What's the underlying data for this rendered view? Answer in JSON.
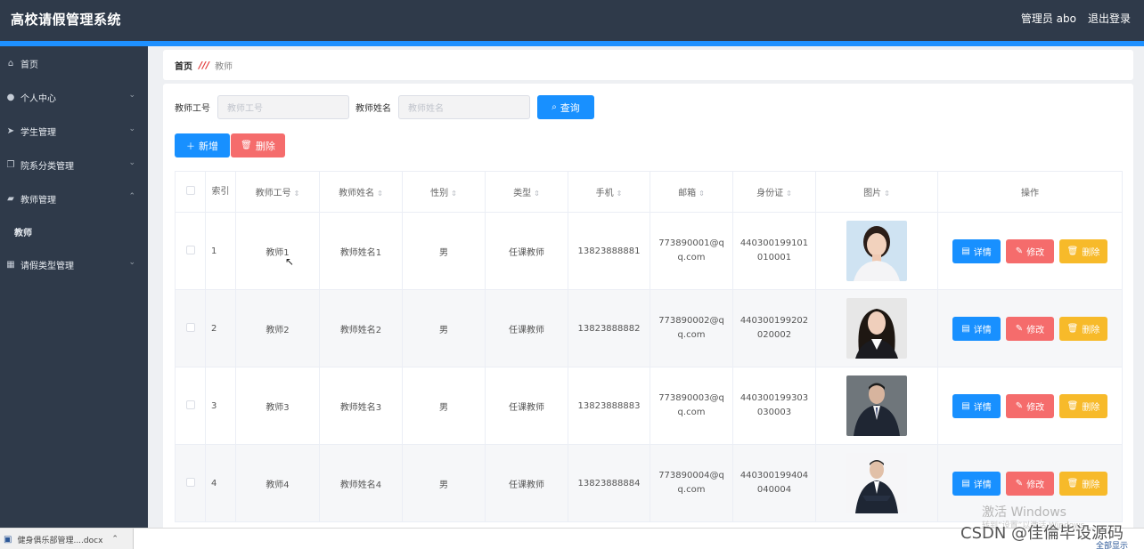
{
  "header": {
    "title": "高校请假管理系统",
    "user": "管理员 abo",
    "logout": "退出登录"
  },
  "sidebar": {
    "items": [
      {
        "label": "首页",
        "icon": "home-icon",
        "glyph": "⌂",
        "expand": ""
      },
      {
        "label": "个人中心",
        "icon": "person-icon",
        "glyph": "●",
        "expand": "⌄"
      },
      {
        "label": "学生管理",
        "icon": "send-icon",
        "glyph": "➤",
        "expand": "⌄"
      },
      {
        "label": "院系分类管理",
        "icon": "copy-icon",
        "glyph": "❐",
        "expand": "⌄"
      },
      {
        "label": "教师管理",
        "icon": "briefcase-icon",
        "glyph": "▰",
        "expand": "⌃"
      },
      {
        "label": "请假类型管理",
        "icon": "grid-icon",
        "glyph": "▦",
        "expand": "⌄"
      }
    ],
    "sub_item": "教师"
  },
  "breadcrumb": {
    "home": "首页",
    "separator": "///",
    "current": "教师"
  },
  "search": {
    "field1_label": "教师工号",
    "field1_placeholder": "教师工号",
    "field2_label": "教师姓名",
    "field2_placeholder": "教师姓名",
    "query": "查询"
  },
  "actions": {
    "add": "新增",
    "delete": "删除"
  },
  "table": {
    "headers": [
      "索引",
      "教师工号",
      "教师姓名",
      "性别",
      "类型",
      "手机",
      "邮箱",
      "身份证",
      "图片",
      "操作"
    ],
    "rows": [
      {
        "idx": "1",
        "no": "教师1",
        "name": "教师姓名1",
        "sex": "男",
        "type": "任课教师",
        "phone": "13823888881",
        "email": "773890001@qq.com",
        "id": "440300199101010001",
        "photo": "photo-female-1"
      },
      {
        "idx": "2",
        "no": "教师2",
        "name": "教师姓名2",
        "sex": "男",
        "type": "任课教师",
        "phone": "13823888882",
        "email": "773890002@qq.com",
        "id": "440300199202020002",
        "photo": "photo-female-2"
      },
      {
        "idx": "3",
        "no": "教师3",
        "name": "教师姓名3",
        "sex": "男",
        "type": "任课教师",
        "phone": "13823888883",
        "email": "773890003@qq.com",
        "id": "440300199303030003",
        "photo": "photo-male-1"
      },
      {
        "idx": "4",
        "no": "教师4",
        "name": "教师姓名4",
        "sex": "男",
        "type": "任课教师",
        "phone": "13823888884",
        "email": "773890004@qq.com",
        "id": "440300199404040004",
        "photo": "photo-male-2"
      }
    ],
    "ops": {
      "detail": "详情",
      "edit": "修改",
      "remove": "删除"
    }
  },
  "taskbar": {
    "doc": "健身俱乐部管理....docx",
    "show_all": "全部显示"
  },
  "watermark": {
    "activate": "激活 Windows",
    "activate_hint": "转到“设置”以激活 Windows。",
    "csdn": "CSDN @佳倫毕设源码"
  },
  "colors": {
    "header_bg": "#2f3a4a",
    "accent": "#1e90ff",
    "primary": "#1890ff",
    "danger": "#f56c6c",
    "warning": "#f7ba2a"
  }
}
